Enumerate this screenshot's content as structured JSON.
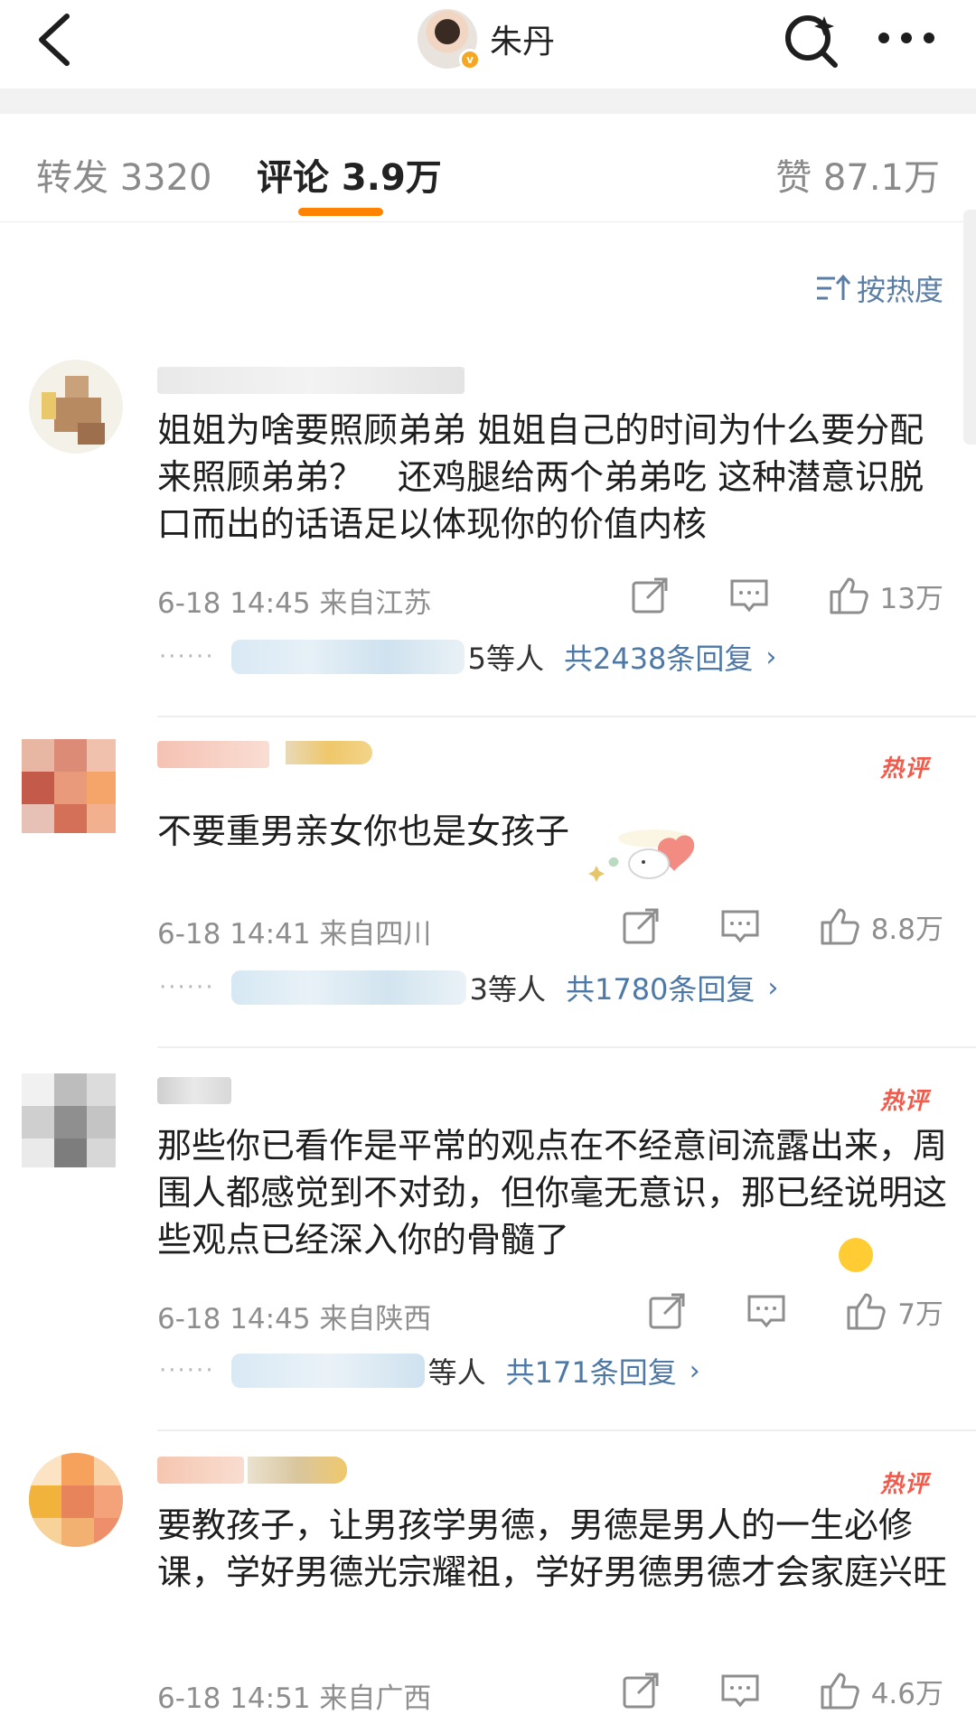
{
  "header": {
    "back_icon": "chevron-left-icon",
    "account_name": "朱丹",
    "verified_badge": "v",
    "search_icon": "search-icon",
    "more_icon": "more-dots-icon"
  },
  "tabs": {
    "repost": "转发 3320",
    "comments": "评论 3.9万",
    "likes": "赞 87.1万",
    "active": "comments",
    "accent_color": "#ff8200"
  },
  "sort": {
    "label": "按热度",
    "icon": "sort-icon"
  },
  "comments": [
    {
      "text": "姐姐为啥要照顾弟弟 姐姐自己的时间为什么要分配来照顾弟弟？　还鸡腿给两个弟弟吃 这种潜意识脱口而出的话语足以体现你的价值内核",
      "meta": "6-18 14:45 来自江苏",
      "likes": "13万",
      "reply_etc": "5等人",
      "reply_total": "共2438条回复",
      "hot": ""
    },
    {
      "text": "不要重男亲女你也是女孩子",
      "meta": "6-18 14:41 来自四川",
      "likes": "8.8万",
      "reply_etc": "3等人",
      "reply_total": "共1780条回复",
      "hot": "热评"
    },
    {
      "text": "那些你已看作是平常的观点在不经意间流露出来，周围人都感觉到不对劲，但你毫无意识，那已经说明这些观点已经深入你的骨髓了",
      "meta": "6-18 14:45 来自陕西",
      "likes": "7万",
      "reply_etc": "等人",
      "reply_total": "共171条回复",
      "hot": "热评"
    },
    {
      "text": "要教孩子，让男孩学男德，男德是男人的一生必修课，学好男德光宗耀祖，学好男德男德才会家庭兴旺",
      "meta": "6-18 14:51 来自广西",
      "likes": "4.6万",
      "hot": "热评"
    }
  ],
  "misc": {
    "reply_arrow": "›",
    "dots": "······",
    "link_color": "#4e79a7",
    "hot_color": "#f15b4c"
  }
}
